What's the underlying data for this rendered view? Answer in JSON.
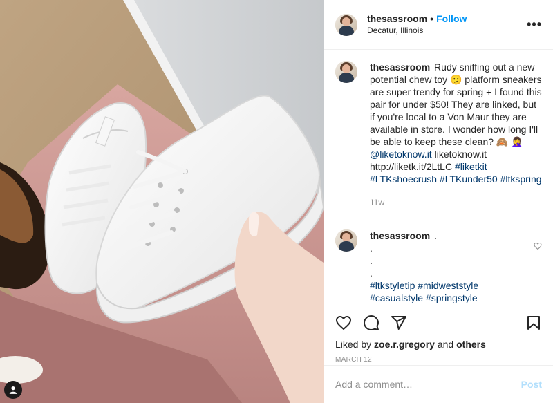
{
  "post": {
    "username": "thesassroom",
    "separator": "•",
    "follow_label": "Follow",
    "location": "Decatur, Illinois",
    "more_label": "•••"
  },
  "caption": {
    "username": "thesassroom",
    "text_1": "Rudy sniffing out a new potential chew toy 🫤 platform sneakers are super trendy for spring + I found this pair for under $50! They are linked, but if you're local to a Von Maur they are available in store. I wonder how long I'll be able to keep these clean? 🙈 🤦‍♀️ ",
    "mention": "@liketoknow.it",
    "text_2": " liketoknow.it http://liketk.it/2LtLC ",
    "hashtags": "#liketkit #LTKshoecrush #LTKunder50 #ltkspring",
    "time": "11w"
  },
  "comment": {
    "username": "thesassroom",
    "text": " .",
    "dots": [
      ".",
      ".",
      "."
    ],
    "hashtags_1": "#ltkstyletip #midweststyle",
    "hashtags_2": "#casualstyle #springstyle"
  },
  "actions": {
    "liked_by_prefix": "Liked by ",
    "liked_by_user": "zoe.r.gregory",
    "liked_by_and": " and ",
    "liked_by_others": "others",
    "date": "MARCH 12"
  },
  "add_comment": {
    "placeholder": "Add a comment…",
    "post_label": "Post"
  },
  "colors": {
    "link_blue": "#0095f6",
    "hashtag": "#00376b",
    "muted": "#8e8e8e",
    "post_disabled": "#b2dffc"
  },
  "icons": [
    "heart-icon",
    "comment-icon",
    "share-icon",
    "bookmark-icon",
    "user-tag-icon",
    "more-icon"
  ]
}
